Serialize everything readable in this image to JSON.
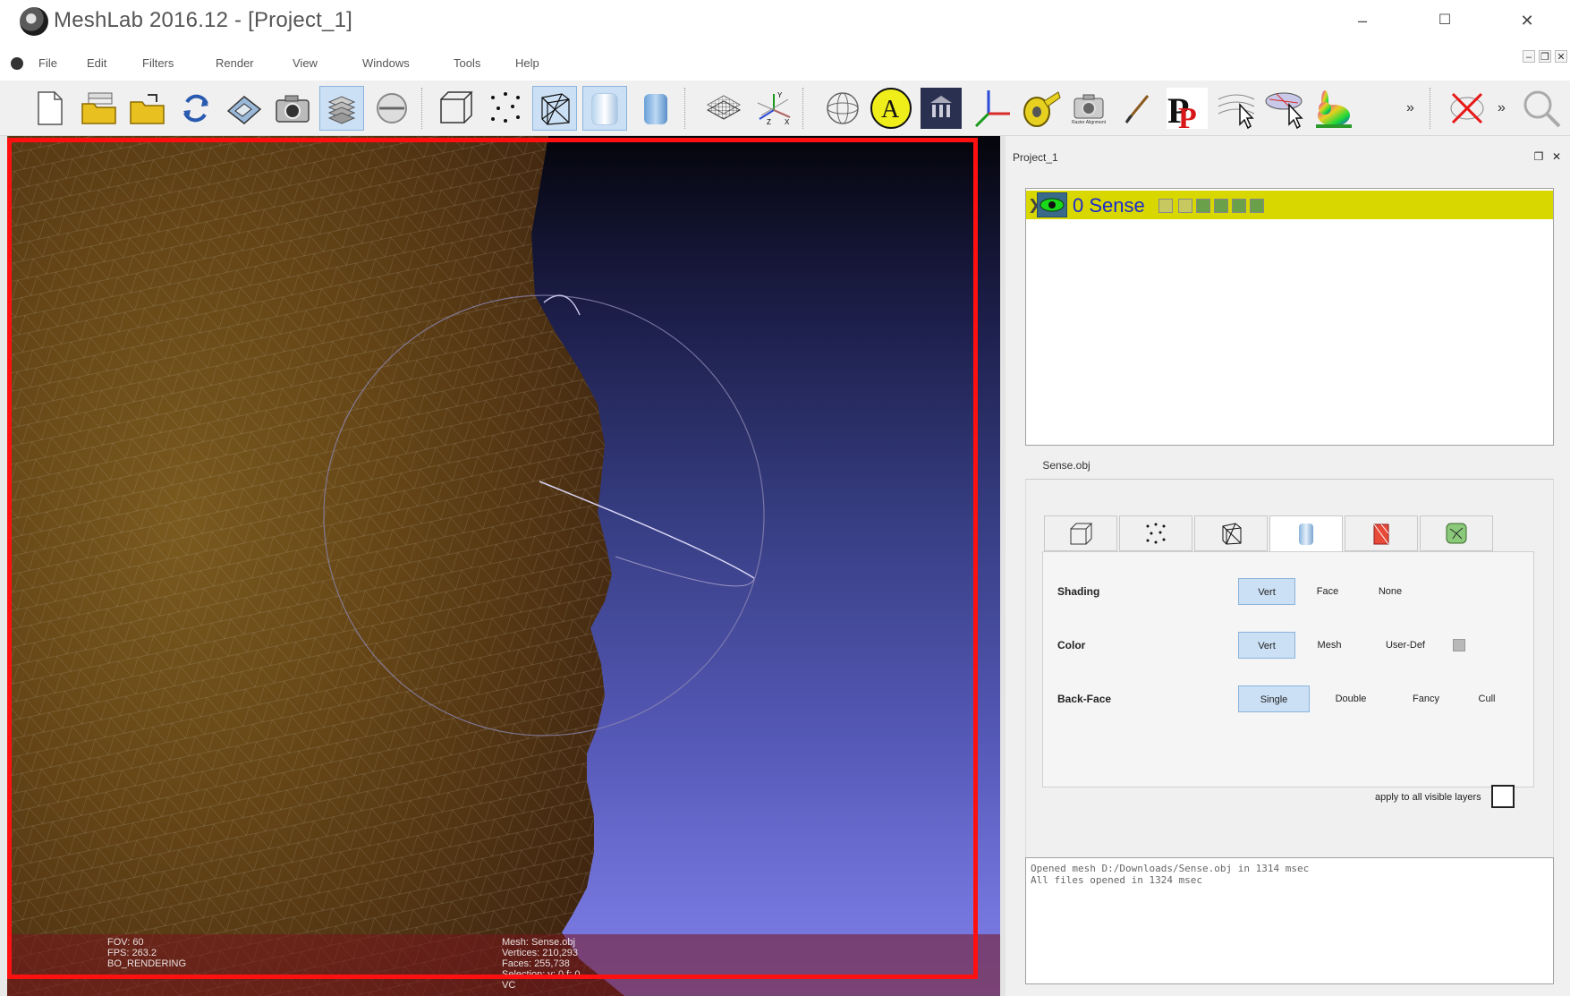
{
  "window": {
    "title": "MeshLab 2016.12 - [Project_1]",
    "minimize": "–",
    "maximize": "☐",
    "close": "✕"
  },
  "menubar": {
    "items": [
      "File",
      "Edit",
      "Filters",
      "Render",
      "View",
      "Windows",
      "Tools",
      "Help"
    ],
    "mdi": {
      "minimize": "–",
      "restore": "❐",
      "close": "✕"
    }
  },
  "toolbar": {
    "raster_alignment_caption": "Raster Alignment",
    "annotate_letter": "A",
    "overflow_1": "»",
    "overflow_2": "»",
    "icons": [
      "new-project-icon",
      "open-project-icon",
      "open-mesh-icon",
      "reload-icon",
      "save-icon",
      "snapshot-icon",
      "layers-icon",
      "raster-icon",
      "bounding-box-icon",
      "points-icon",
      "wireframe-icon",
      "flat-lines-icon",
      "smooth-icon",
      "grid-icon",
      "axis-icon",
      "sphere-icon",
      "annotate-icon",
      "museum-icon",
      "measure-axes-icon",
      "tape-measure-icon",
      "raster-alignment-icon",
      "paint-brush-icon",
      "point-picker-icon",
      "select-vertices-icon",
      "select-faces-icon",
      "color-bunny-icon",
      "close-x-icon",
      "search-icon"
    ],
    "active": [
      "layers-icon",
      "wireframe-icon",
      "flat-lines-icon"
    ]
  },
  "viewport": {
    "hud_left": [
      "FOV: 60",
      "FPS:   263.2",
      "BO_RENDERING"
    ],
    "hud_right": [
      "Mesh: Sense.obj",
      "Vertices: 210,293",
      "Faces: 255,738",
      "Selection: v: 0 f: 0",
      "VC"
    ]
  },
  "panel": {
    "title": "Project_1",
    "float": "❐",
    "close": "✕",
    "layers": [
      {
        "name": "0 Sense",
        "visible": true,
        "expand": "❯"
      }
    ],
    "properties_tab": "Sense.obj",
    "render_tabs": [
      "box-mode-icon",
      "points-mode-icon",
      "wireframe-mode-icon",
      "solid-mode-icon",
      "texture-mode-icon",
      "misc-mode-icon"
    ],
    "active_render_tab": 3,
    "shading": {
      "label": "Shading",
      "options": [
        "Vert",
        "Face",
        "None"
      ],
      "selected": "Vert"
    },
    "color": {
      "label": "Color",
      "options": [
        "Vert",
        "Mesh",
        "User-Def"
      ],
      "selected": "Vert",
      "user_def_color": "#b8b8b8"
    },
    "backface": {
      "label": "Back-Face",
      "options": [
        "Single",
        "Double",
        "Fancy",
        "Cull"
      ],
      "selected": "Single"
    },
    "apply_all_label": "apply to all visible layers",
    "apply_all_checked": false
  },
  "log": [
    "Opened mesh D:/Downloads/Sense.obj in 1314 msec",
    "All files opened in 1324 msec"
  ],
  "colors": {
    "highlight": "#ff1010",
    "layer_selected": "#d8d800",
    "layer_name": "#1a2ad0",
    "button_selected": "#cbe0f5"
  }
}
